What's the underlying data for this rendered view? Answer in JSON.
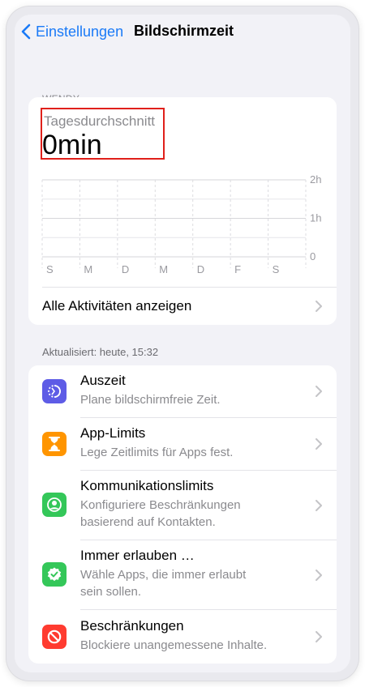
{
  "nav": {
    "back_label": "Einstellungen",
    "title": "Bildschirmzeit"
  },
  "section": {
    "user": "WENDY"
  },
  "summary": {
    "label": "Tagesdurchschnitt",
    "value": "0min"
  },
  "chart_data": {
    "type": "bar",
    "categories": [
      "S",
      "M",
      "D",
      "M",
      "D",
      "F",
      "S"
    ],
    "values": [
      0,
      0,
      0,
      0,
      0,
      0,
      0
    ],
    "y_ticks": [
      "2h",
      "1h",
      "0"
    ],
    "ylim": [
      0,
      2
    ],
    "grid": true
  },
  "activities": {
    "label": "Alle Aktivitäten anzeigen"
  },
  "updated": "Aktualisiert: heute, 15:32",
  "items": [
    {
      "title": "Auszeit",
      "sub1": "Plane bildschirmfreie Zeit.",
      "sub2": "",
      "color": "#5e5ce6",
      "icon": "downtime-icon"
    },
    {
      "title": "App-Limits",
      "sub1": "Lege Zeitlimits für Apps fest.",
      "sub2": "",
      "color": "#ff9500",
      "icon": "hourglass-icon"
    },
    {
      "title": "Kommunikationslimits",
      "sub1": "Konfiguriere Beschränkungen",
      "sub2": "basierend auf Kontakten.",
      "color": "#34c759",
      "icon": "person-circle-icon"
    },
    {
      "title": "Immer erlauben …",
      "sub1": "Wähle Apps, die immer erlaubt",
      "sub2": "sein sollen.",
      "color": "#34c759",
      "icon": "checkmark-badge-icon"
    },
    {
      "title": "Beschränkungen",
      "sub1": "Blockiere unangemessene Inhalte.",
      "sub2": "",
      "color": "#ff3b30",
      "icon": "restriction-icon"
    }
  ]
}
